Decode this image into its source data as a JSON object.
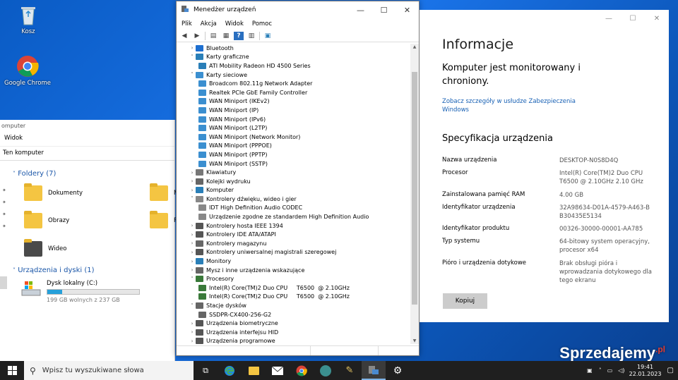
{
  "desktop": {
    "icons": [
      {
        "label": "Kosz"
      },
      {
        "label": "Google Chrome"
      }
    ]
  },
  "explorer": {
    "title": "omputer",
    "menu_view": "Widok",
    "address": "Ten komputer",
    "folders_header": "Foldery (7)",
    "folders": [
      "Dokumenty",
      "Obrazy",
      "Wideo"
    ],
    "folder_cut_m": "M",
    "folder_cut_p": "P",
    "devices_header": "Urządzenia i dyski (1)",
    "disk_name": "Dysk lokalny (C:)",
    "disk_free": "199 GB wolnych z 237 GB",
    "disk_used_fraction": 0.16
  },
  "devmgr": {
    "title": "Menedżer urządzeń",
    "menu": [
      "Plik",
      "Akcja",
      "Widok",
      "Pomoc"
    ],
    "tree": [
      {
        "label": "Bluetooth",
        "level": 0,
        "exp": "›",
        "color": "#1e6fd0"
      },
      {
        "label": "Karty graficzne",
        "level": 0,
        "exp": "˅",
        "color": "#2a7fb8"
      },
      {
        "label": "ATI Mobility Radeon HD 4500 Series",
        "level": 1,
        "exp": "",
        "color": "#2a7fb8"
      },
      {
        "label": "Karty sieciowe",
        "level": 0,
        "exp": "˅",
        "color": "#3b8fd0"
      },
      {
        "label": "Broadcom 802.11g Network Adapter",
        "level": 1,
        "exp": "",
        "color": "#3b8fd0"
      },
      {
        "label": "Realtek PCIe GbE Family Controller",
        "level": 1,
        "exp": "",
        "color": "#3b8fd0"
      },
      {
        "label": "WAN Miniport (IKEv2)",
        "level": 1,
        "exp": "",
        "color": "#3b8fd0"
      },
      {
        "label": "WAN Miniport (IP)",
        "level": 1,
        "exp": "",
        "color": "#3b8fd0"
      },
      {
        "label": "WAN Miniport (IPv6)",
        "level": 1,
        "exp": "",
        "color": "#3b8fd0"
      },
      {
        "label": "WAN Miniport (L2TP)",
        "level": 1,
        "exp": "",
        "color": "#3b8fd0"
      },
      {
        "label": "WAN Miniport (Network Monitor)",
        "level": 1,
        "exp": "",
        "color": "#3b8fd0"
      },
      {
        "label": "WAN Miniport (PPPOE)",
        "level": 1,
        "exp": "",
        "color": "#3b8fd0"
      },
      {
        "label": "WAN Miniport (PPTP)",
        "level": 1,
        "exp": "",
        "color": "#3b8fd0"
      },
      {
        "label": "WAN Miniport (SSTP)",
        "level": 1,
        "exp": "",
        "color": "#3b8fd0"
      },
      {
        "label": "Klawiatury",
        "level": 0,
        "exp": "›",
        "color": "#777777"
      },
      {
        "label": "Kolejki wydruku",
        "level": 0,
        "exp": "›",
        "color": "#666666"
      },
      {
        "label": "Komputer",
        "level": 0,
        "exp": "›",
        "color": "#2a7fb8"
      },
      {
        "label": "Kontrolery dźwięku, wideo i gier",
        "level": 0,
        "exp": "˅",
        "color": "#888888"
      },
      {
        "label": "IDT High Definition Audio CODEC",
        "level": 1,
        "exp": "",
        "color": "#888888"
      },
      {
        "label": "Urządzenie zgodne ze standardem High Definition Audio",
        "level": 1,
        "exp": "",
        "color": "#888888"
      },
      {
        "label": "Kontrolery hosta IEEE 1394",
        "level": 0,
        "exp": "›",
        "color": "#555555"
      },
      {
        "label": "Kontrolery IDE ATA/ATAPI",
        "level": 0,
        "exp": "›",
        "color": "#555555"
      },
      {
        "label": "Kontrolery magazynu",
        "level": 0,
        "exp": "›",
        "color": "#666666"
      },
      {
        "label": "Kontrolery uniwersalnej magistrali szeregowej",
        "level": 0,
        "exp": "›",
        "color": "#555555"
      },
      {
        "label": "Monitory",
        "level": 0,
        "exp": "›",
        "color": "#2a7fb8"
      },
      {
        "label": "Mysz i inne urządzenia wskazujące",
        "level": 0,
        "exp": "›",
        "color": "#666666"
      },
      {
        "label": "Procesory",
        "level": 0,
        "exp": "˅",
        "color": "#3a7a3a"
      },
      {
        "label": "Intel(R) Core(TM)2 Duo CPU     T6500  @ 2.10GHz",
        "level": 1,
        "exp": "",
        "color": "#3a7a3a"
      },
      {
        "label": "Intel(R) Core(TM)2 Duo CPU     T6500  @ 2.10GHz",
        "level": 1,
        "exp": "",
        "color": "#3a7a3a"
      },
      {
        "label": "Stacje dysków",
        "level": 0,
        "exp": "˅",
        "color": "#666666"
      },
      {
        "label": "SSDPR-CX400-256-G2",
        "level": 1,
        "exp": "",
        "color": "#666666"
      },
      {
        "label": "Urządzenia biometryczne",
        "level": 0,
        "exp": "›",
        "color": "#555555"
      },
      {
        "label": "Urządzenia interfejsu HID",
        "level": 0,
        "exp": "›",
        "color": "#555555"
      },
      {
        "label": "Urządzenia programowe",
        "level": 0,
        "exp": "›",
        "color": "#555555"
      }
    ]
  },
  "settings": {
    "title": "Informacje",
    "protection": "Komputer jest monitorowany i chroniony.",
    "link": "Zobacz szczegóły w usłudze Zabezpieczenia Windows",
    "spec_title": "Specyfikacja urządzenia",
    "specs": [
      {
        "label": "Nazwa urządzenia",
        "value": "DESKTOP-N0S8D4Q"
      },
      {
        "label": "Procesor",
        "value": "Intel(R) Core(TM)2 Duo CPU T6500 @ 2.10GHz 2.10 GHz"
      },
      {
        "label": "Zainstalowana pamięć RAM",
        "value": "4.00 GB"
      },
      {
        "label": "Identyfikator urządzenia",
        "value": "32A98634-D01A-4579-A463-BB30435E5134"
      },
      {
        "label": "Identyfikator produktu",
        "value": "00326-30000-00001-AA785"
      },
      {
        "label": "Typ systemu",
        "value": "64-bitowy system operacyjny, procesor x64"
      },
      {
        "label": "Pióro i urządzenia dotykowe",
        "value": "Brak obsługi pióra i wprowadzania dotykowego dla tego ekranu"
      }
    ],
    "copy_button": "Kopiuj"
  },
  "taskbar": {
    "search_placeholder": "Wpisz tu wyszukiwane słowa",
    "time": "19:41",
    "date": "22.01.2023"
  },
  "watermark": {
    "text": "Sprzedajemy",
    "suffix": ".pl"
  }
}
